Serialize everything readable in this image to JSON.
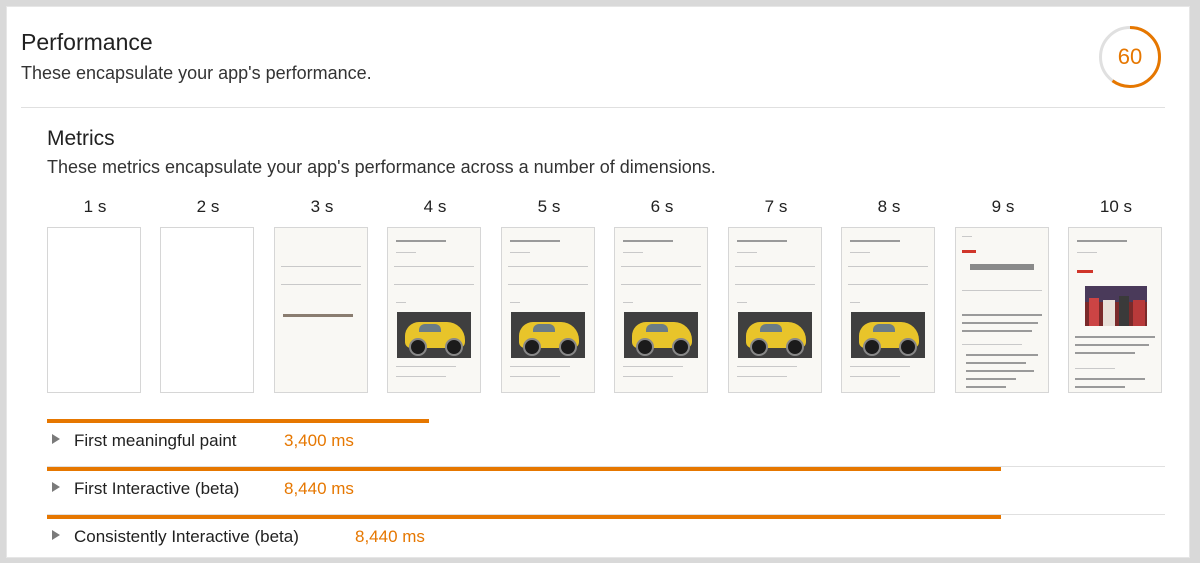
{
  "performance": {
    "title": "Performance",
    "description": "These encapsulate your app's performance.",
    "score": "60",
    "score_fraction": 0.6,
    "accent_color": "#e67700"
  },
  "metrics": {
    "title": "Metrics",
    "description": "These metrics encapsulate your app's performance across a number of dimensions.",
    "frame_labels": [
      "1 s",
      "2 s",
      "3 s",
      "4 s",
      "5 s",
      "6 s",
      "7 s",
      "8 s",
      "9 s",
      "10 s"
    ],
    "items": [
      {
        "label": "First meaningful paint",
        "value": "3,400 ms",
        "ms": 3400
      },
      {
        "label": "First Interactive (beta)",
        "value": "8,440 ms",
        "ms": 8440
      },
      {
        "label": "Consistently Interactive (beta)",
        "value": "8,440 ms",
        "ms": 8440
      }
    ]
  },
  "icons": {
    "expand": "triangle-right-icon"
  }
}
